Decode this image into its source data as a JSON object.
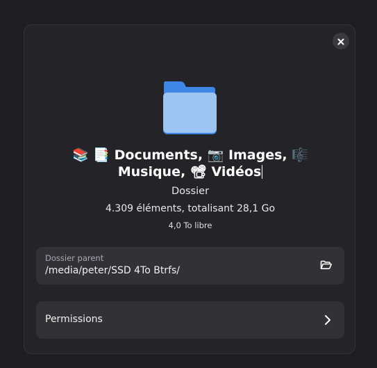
{
  "dialog": {
    "close_icon": "close-icon",
    "folder_icon": "folder-icon",
    "folder_color": "#8fb9ee",
    "title": "📚 📑 Documents, 📷 Images, 🎼 Musique, 📽 Vidéos",
    "kind": "Dossier",
    "summary": "4.309 éléments, totalisant 28,1 Go",
    "free_space": "4,0 To libre"
  },
  "parent_folder": {
    "label": "Dossier parent",
    "value": "/media/peter/SSD 4To Btrfs/",
    "open_icon": "folder-open-icon"
  },
  "permissions": {
    "label": "Permissions",
    "chevron_icon": "chevron-right-icon"
  }
}
